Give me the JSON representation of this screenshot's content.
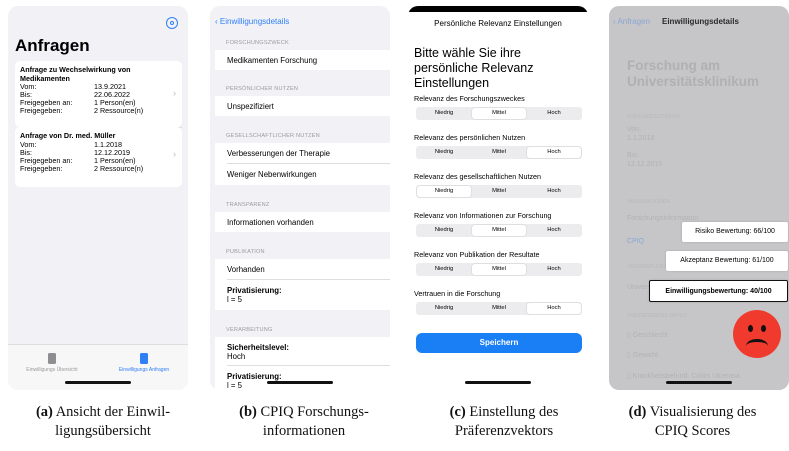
{
  "panel_a": {
    "title": "Anfragen",
    "requests": [
      {
        "title": "Anfrage zu Wechselwirkung von Medikamenten",
        "rows": [
          {
            "label": "Vom:",
            "value": "13.9.2021"
          },
          {
            "label": "Bis:",
            "value": "22.06.2022"
          },
          {
            "label": "Freigegeben an:",
            "value": "1 Person(en)"
          },
          {
            "label": "Freigegeben:",
            "value": "2 Ressource(n)"
          }
        ]
      },
      {
        "title": "Anfrage von Dr. med. Müller",
        "rows": [
          {
            "label": "Vom:",
            "value": "1.1.2018"
          },
          {
            "label": "Bis:",
            "value": "12.12.2019"
          },
          {
            "label": "Freigegeben an:",
            "value": "1 Person(en)"
          },
          {
            "label": "Freigegeben:",
            "value": "2 Ressource(n)"
          }
        ]
      }
    ],
    "tabs": [
      "Einwilligungs Übersicht",
      "Einwilligungs Anfragen"
    ],
    "accent": "#2f7ff7"
  },
  "panel_b": {
    "back": "Einwilligungsdetails",
    "sections": [
      {
        "label": "FORSCHUNGSZWECK",
        "items": [
          "Medikamenten Forschung"
        ]
      },
      {
        "label": "PERSÖNLICHER NUTZEN",
        "items": [
          "Unspezifiziert"
        ]
      },
      {
        "label": "GESELLSCHAFTLICHER NUTZEN",
        "items": [
          "Verbesserungen der Therapie",
          "Weniger Nebenwirkungen"
        ]
      },
      {
        "label": "TRANSPARENZ",
        "items": [
          "Informationen vorhanden"
        ]
      },
      {
        "label": "PUBLIKATION",
        "items": [
          "Vorhanden"
        ],
        "extra_title": "Privatisierung:",
        "extra_value": "l = 5"
      },
      {
        "label": "VERARBEITUNG",
        "extra_title": "Sicherheitslevel:",
        "extra_value": "Hoch",
        "extra2_title": "Privatisierung:",
        "extra2_value": "l = 5"
      }
    ]
  },
  "panel_c": {
    "header": "Persönliche Relevanz Einstellungen",
    "heading": "Bitte wähle Sie ihre persönliche Relevanz Einstellungen",
    "options": [
      "Niedrig",
      "Mittel",
      "Hoch"
    ],
    "questions": [
      {
        "label": "Relevanz des Forschungszweckes",
        "selected": 1
      },
      {
        "label": "Relevanz des persönlichen Nutzen",
        "selected": 2
      },
      {
        "label": "Relevanz des gesellschaftlichen Nutzen",
        "selected": 0
      },
      {
        "label": "Relevanz von Informationen zur Forschung",
        "selected": 1
      },
      {
        "label": "Relevanz von Publikation der Resultate",
        "selected": 1
      },
      {
        "label": "Vertrauen in die Forschung",
        "selected": 2
      }
    ],
    "save": "Speichern"
  },
  "panel_d": {
    "back": "Anfragen",
    "nav_title": "Einwilligungsdetails",
    "heading": "Forschung am Universitätsklinikum",
    "zeitraum_label": "FREIGABEZEITRAUM",
    "von_label": "Von:",
    "von_value": "1.1.2018",
    "bis_label": "Bis:",
    "bis_value": "12.12.2019",
    "info_label": "INFORMATIONEN",
    "info_item": "Forschungsinformation",
    "cpiq": "CPIQ",
    "zweck_label": "VERWENDUNGSZWECK",
    "univ": "Universität",
    "daten_label": "FREIGEGEBENE DATEN",
    "daten": [
      "Geschlecht",
      "Gewicht",
      "Krankheitsbefund: Colitis Ulcerosa"
    ],
    "scores": [
      "Risiko Bewertung: 66/100",
      "Akzeptanz Bewertung: 61/100",
      "Einwilligungsbewertung: 40/100"
    ],
    "face_color": "#f03a2e"
  },
  "captions": [
    {
      "tag": "(a)",
      "text": "Ansicht der Einwil-ligungsübersicht",
      "l1": "Ansicht der Einwil-",
      "l2": "ligungsübersicht"
    },
    {
      "tag": "(b)",
      "l1": "CPIQ Forschungs-",
      "l2": "informationen"
    },
    {
      "tag": "(c)",
      "l1": "Einstellung des",
      "l2": "Präferenzvektors"
    },
    {
      "tag": "(d)",
      "l1": "Visualisierung des",
      "l2": "CPIQ Scores"
    }
  ]
}
